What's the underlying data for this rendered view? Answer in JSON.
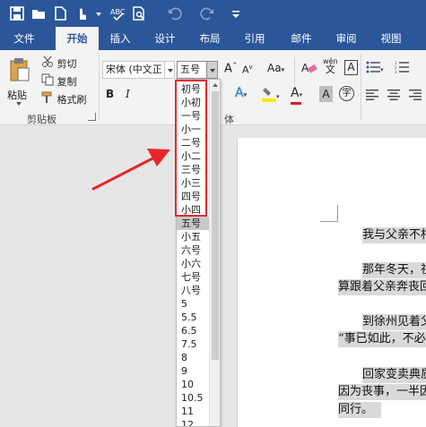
{
  "title_bar": {
    "icons": [
      "save-icon",
      "open-folder-icon",
      "new-document-icon",
      "touch-mode-icon",
      "dropdown-arrow-icon",
      "spelling-check-icon",
      "print-preview-icon",
      "undo-icon",
      "redo-icon",
      "customize-toolbar-icon"
    ]
  },
  "tabs": [
    "文件",
    "开始",
    "插入",
    "设计",
    "布局",
    "引用",
    "邮件",
    "审阅",
    "视图"
  ],
  "active_tab": "开始",
  "clipboard": {
    "paste": "粘贴",
    "cut": "剪切",
    "copy": "复制",
    "format_painter": "格式刷",
    "group_label": "剪贴板"
  },
  "font": {
    "font_name": "宋体 (中文正",
    "font_size": "五号",
    "grow": "A",
    "shrink": "A",
    "case": "Aa",
    "clear": "A",
    "phonetic": "wén",
    "border_char": "A",
    "bold": "B",
    "italic": "I",
    "text_effect": "A",
    "font_color": "A",
    "char_shading": "A",
    "enclose": "字",
    "group_label_tail": "体"
  },
  "size_list": {
    "items": [
      "初号",
      "小初",
      "一号",
      "小一",
      "二号",
      "小二",
      "三号",
      "小三",
      "四号",
      "小四",
      "五号",
      "小五",
      "六号",
      "小六",
      "七号",
      "八号",
      "5",
      "5.5",
      "6.5",
      "7.5",
      "8",
      "9",
      "10",
      "10.5",
      "11",
      "12"
    ],
    "selected": "五号"
  },
  "document": {
    "lines": [
      "我与父亲不相",
      "那年冬天，祖",
      "算跟着父亲奔丧回",
      "到徐州见着父",
      "“事已如此，不必",
      "回家变卖典质",
      "因为丧事，一半因",
      "同行。"
    ]
  },
  "colors": {
    "accent": "#2b579a",
    "annotation": "#e8262a",
    "highlight_yellow": "#ffe600",
    "font_red": "#e01e1e"
  }
}
